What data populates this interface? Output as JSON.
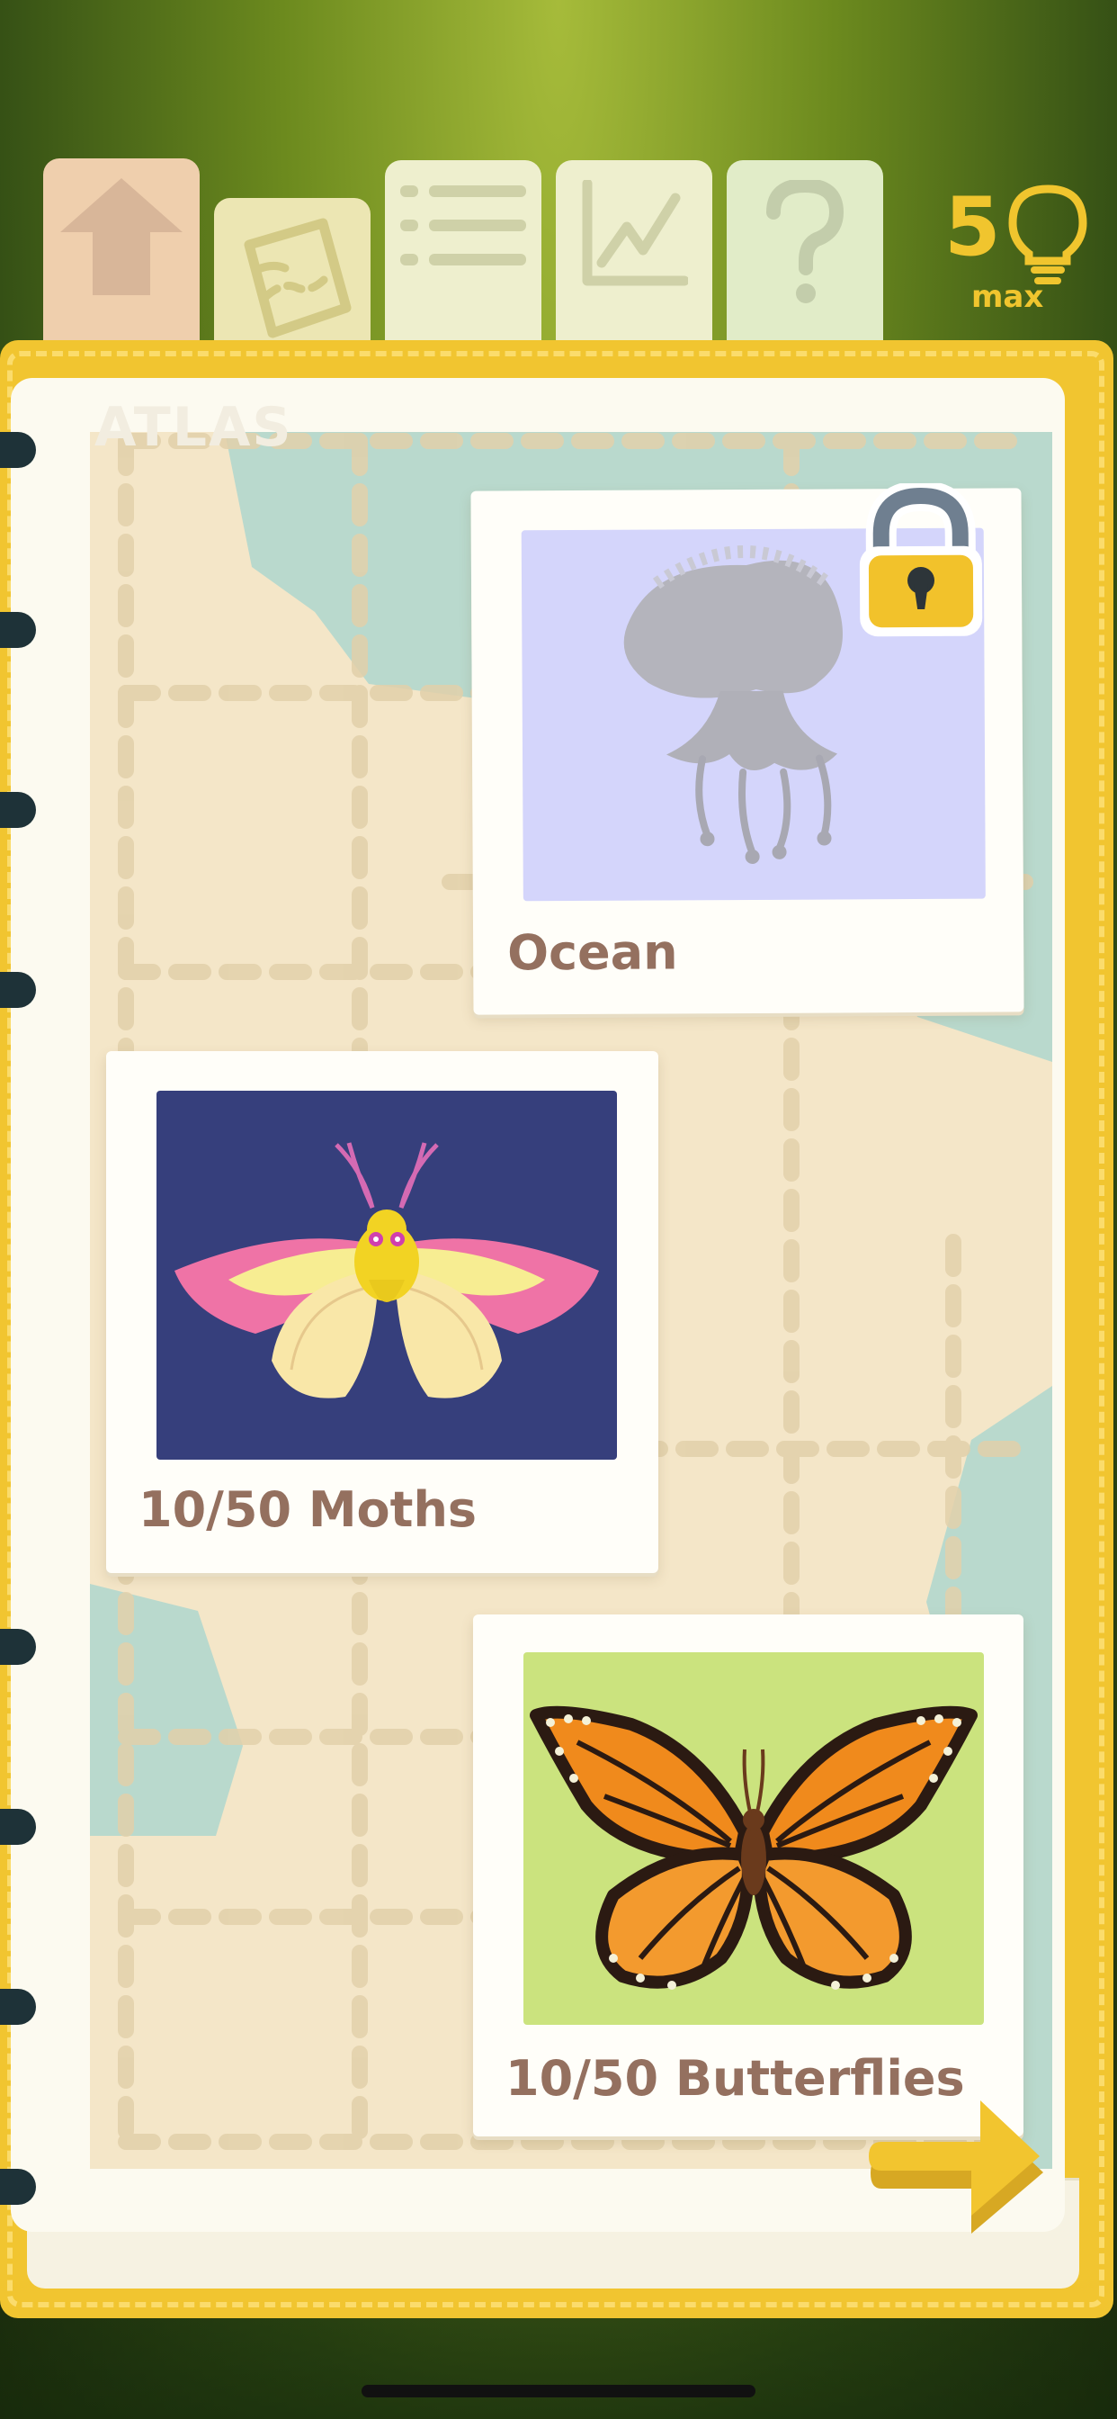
{
  "tabs": [
    {
      "name": "home",
      "icon": "home-icon"
    },
    {
      "name": "journal",
      "icon": "map-pocket-icon"
    },
    {
      "name": "list",
      "icon": "list-icon"
    },
    {
      "name": "stats",
      "icon": "chart-icon"
    },
    {
      "name": "help",
      "icon": "question-icon"
    }
  ],
  "hints": {
    "count": "5",
    "label": "max",
    "icon": "lightbulb-icon"
  },
  "page": {
    "title": "ATLAS"
  },
  "cards": {
    "ocean": {
      "label": "Ocean",
      "locked": true,
      "image": "jellyfish-silhouette",
      "icon": "lock-icon"
    },
    "moths": {
      "label": "10/50 Moths",
      "found": 10,
      "total": 50,
      "image": "rosy-maple-moth"
    },
    "butterflies": {
      "label": "10/50 Butterflies",
      "found": 10,
      "total": 50,
      "image": "monarch-butterfly"
    }
  },
  "navigation": {
    "next_icon": "arrow-right-icon"
  },
  "colors": {
    "accent": "#f1c530",
    "label_text": "#94705f",
    "page": "#fcfaf0",
    "map_land": "#f4e6c8",
    "map_water": "#b9d9cd"
  }
}
